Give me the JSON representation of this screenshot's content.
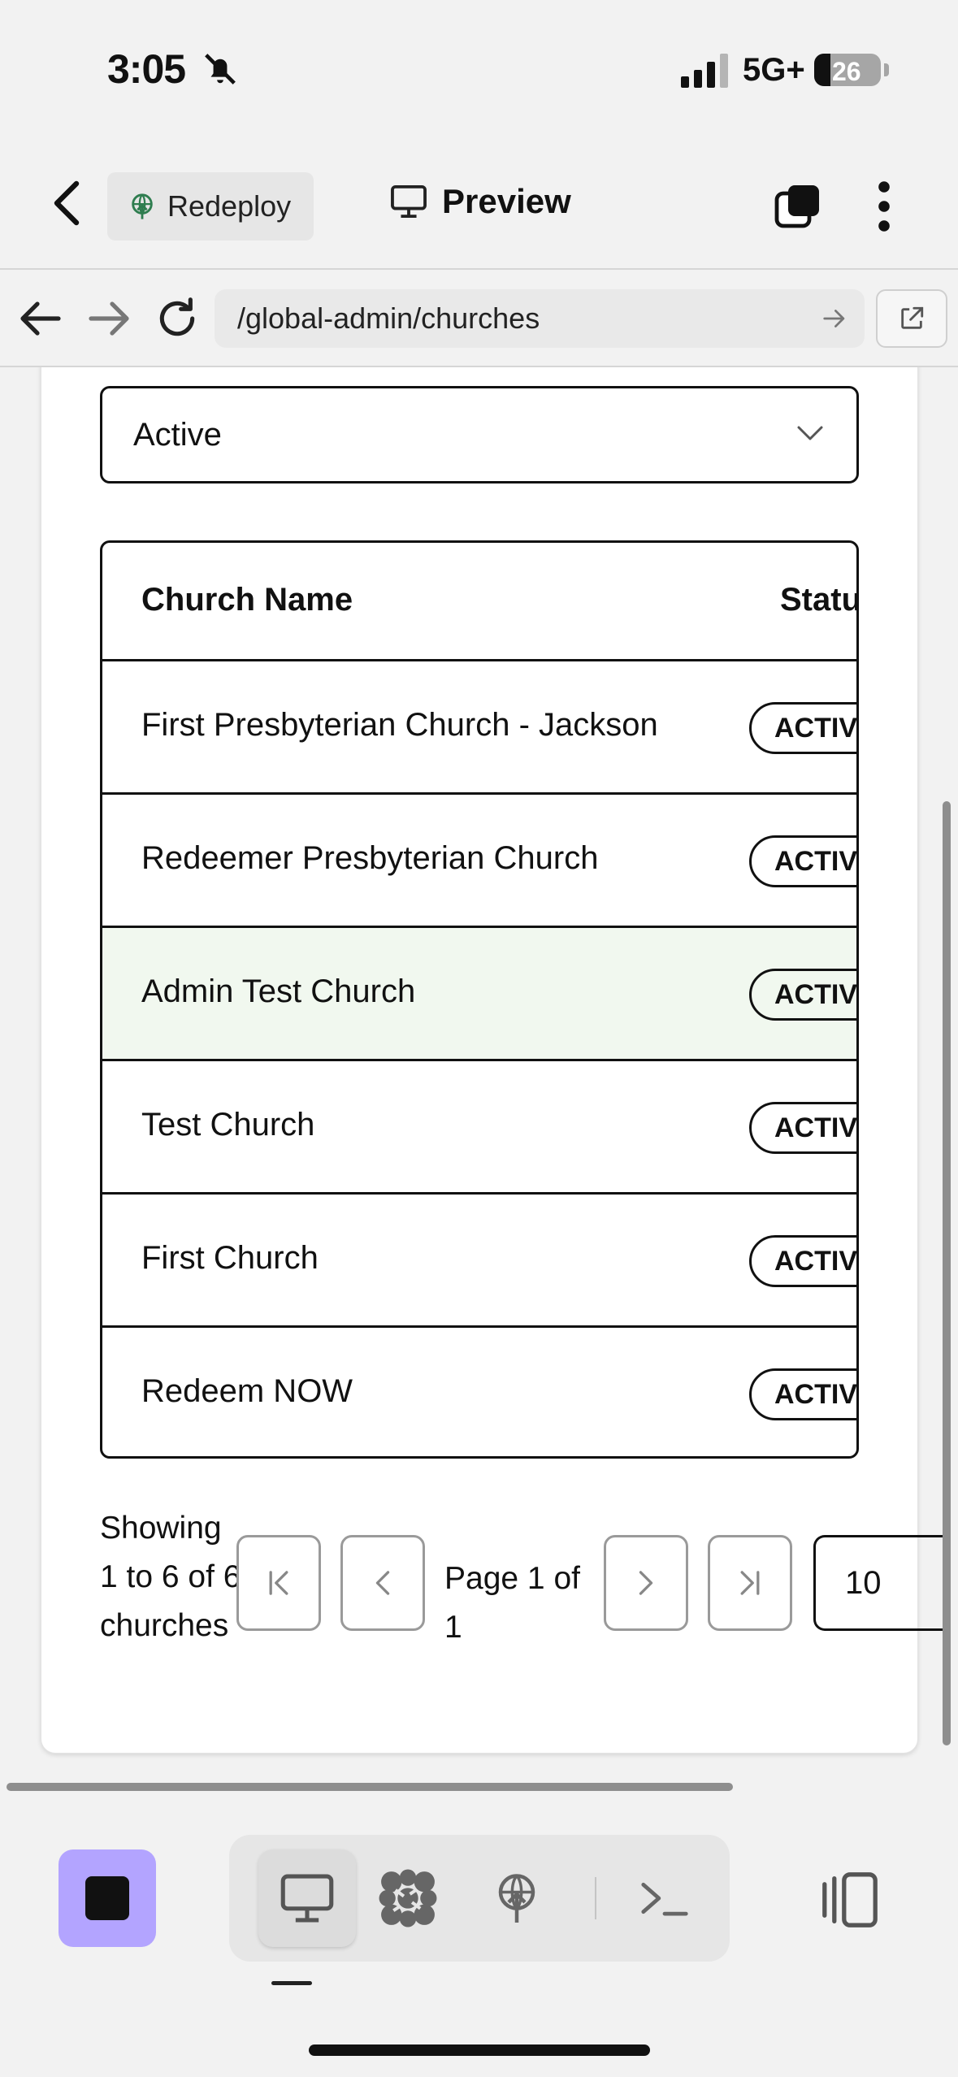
{
  "status_bar": {
    "time": "3:05",
    "network": "5G+",
    "battery": "26"
  },
  "toolbar": {
    "redeploy_label": "Redeploy",
    "preview_label": "Preview"
  },
  "browser": {
    "url": "/global-admin/churches"
  },
  "filter": {
    "selected": "Active"
  },
  "table": {
    "headers": [
      "Church Name",
      "Statu"
    ],
    "rows": [
      {
        "name": "First Presbyterian Church - Jackson",
        "status": "ACTIV",
        "highlighted": false
      },
      {
        "name": "Redeemer Presbyterian Church",
        "status": "ACTIV",
        "highlighted": false
      },
      {
        "name": "Admin Test Church",
        "status": "ACTIV",
        "highlighted": true
      },
      {
        "name": "Test Church",
        "status": "ACTIV",
        "highlighted": false
      },
      {
        "name": "First Church",
        "status": "ACTIV",
        "highlighted": false
      },
      {
        "name": "Redeem NOW",
        "status": "ACTIV",
        "highlighted": false
      }
    ]
  },
  "pagination": {
    "showing_text": "Showing 1 to 6 of 6 churches",
    "page_text": "Page 1 of 1",
    "page_size": "10"
  },
  "colors": {
    "accent": "#b3a4ff",
    "highlight_row": "#f1f8ef",
    "redeploy_icon": "#2e7d4f"
  }
}
